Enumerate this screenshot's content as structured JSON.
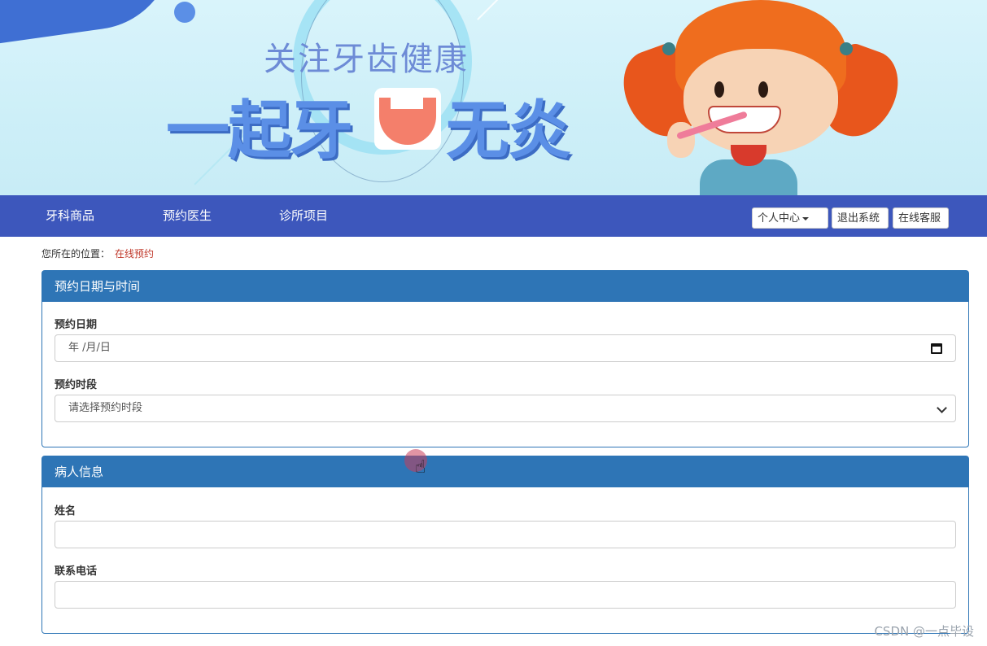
{
  "banner": {
    "title_small": "关注牙齿健康",
    "title_big_left": "一起牙",
    "title_big_right": "无炎"
  },
  "nav": {
    "items": [
      "牙科商品",
      "预约医生",
      "诊所项目"
    ],
    "personal_center": "个人中心",
    "logout": "退出系统",
    "online_service": "在线客服"
  },
  "breadcrumb": {
    "label": "您所在的位置：",
    "current": "在线预约"
  },
  "panels": {
    "appointment": {
      "heading": "预约日期与时间",
      "date_label": "预约日期",
      "date_value": "年 /月/日",
      "slot_label": "预约时段",
      "slot_value": "请选择预约时段"
    },
    "patient": {
      "heading": "病人信息",
      "name_label": "姓名",
      "name_value": "",
      "phone_label": "联系电话",
      "phone_value": ""
    }
  },
  "watermark": "CSDN @一点毕设",
  "colors": {
    "nav_bg": "#3d57bc",
    "panel_heading": "#2e75b6",
    "breadcrumb_current": "#c0392b"
  }
}
